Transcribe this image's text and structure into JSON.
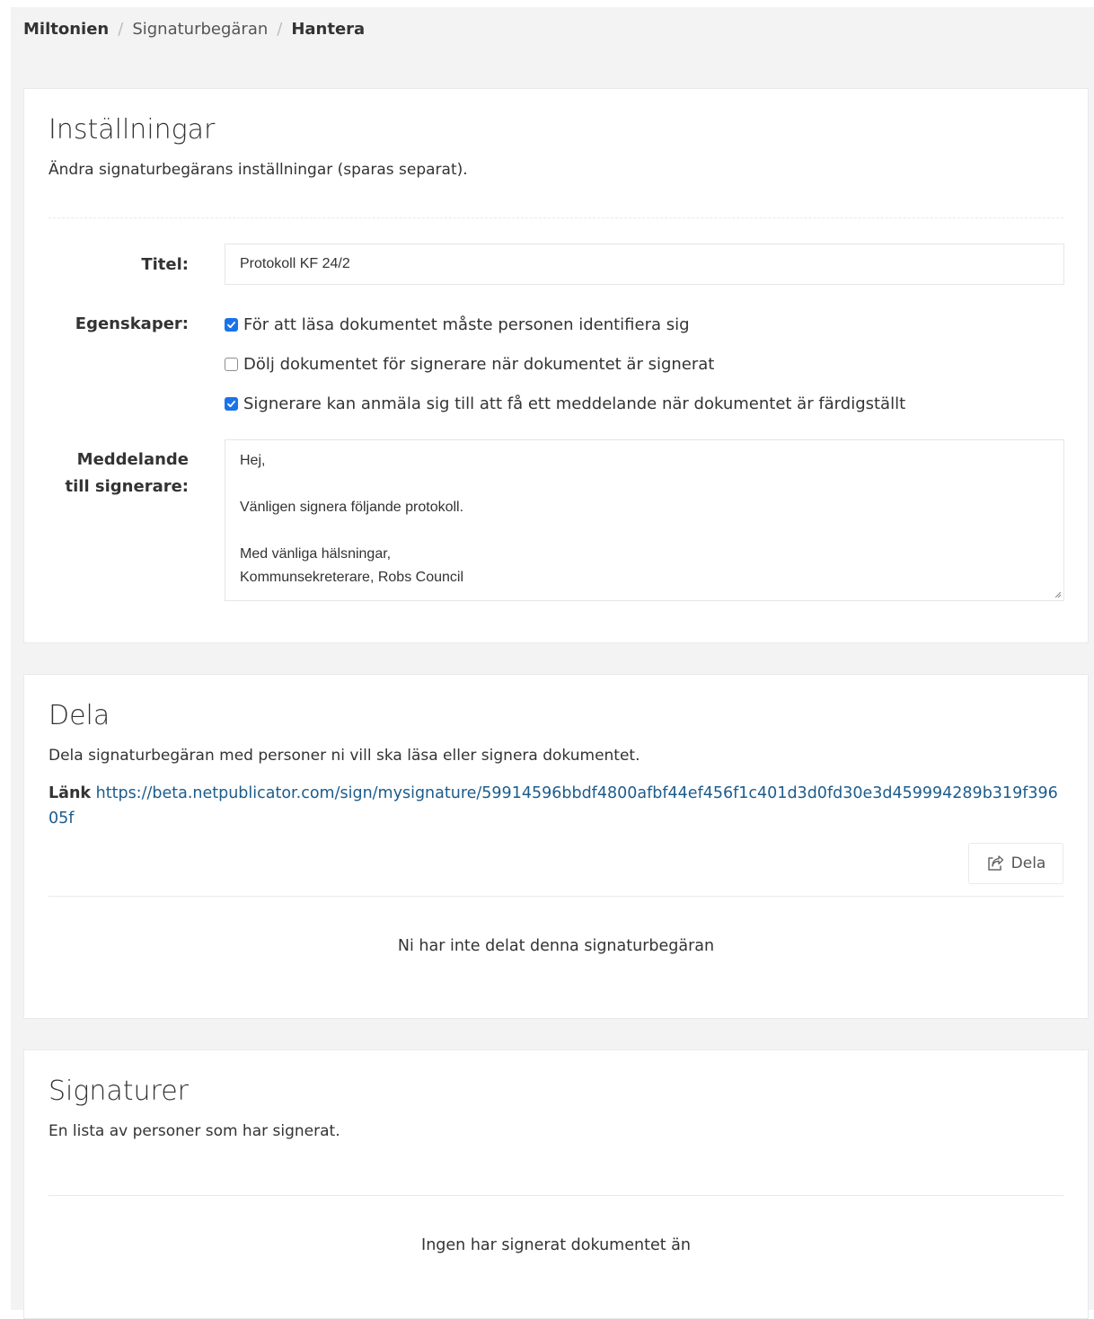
{
  "breadcrumb": {
    "root": "Miltonien",
    "parent": "Signaturbegäran",
    "current": "Hantera",
    "separator": "/"
  },
  "settings": {
    "title": "Inställningar",
    "description": "Ändra signaturbegärans inställningar (sparas separat).",
    "title_field": {
      "label": "Titel:",
      "value": "Protokoll KF 24/2"
    },
    "properties": {
      "label": "Egenskaper:",
      "options": [
        {
          "label": "För att läsa dokumentet måste personen identifiera sig",
          "checked": true
        },
        {
          "label": "Dölj dokumentet för signerare när dokumentet är signerat",
          "checked": false
        },
        {
          "label": "Signerare kan anmäla sig till att få ett meddelande när dokumentet är färdigställt",
          "checked": true
        }
      ]
    },
    "message": {
      "label_line1": "Meddelande",
      "label_line2": "till signerare:",
      "lines": [
        "Hej,",
        "",
        "Vänligen signera följande protokoll.",
        "",
        "Med vänliga hälsningar,",
        "Kommunsekreterare, Robs Council"
      ]
    }
  },
  "share": {
    "title": "Dela",
    "description": "Dela signaturbegäran med personer ni vill ska läsa eller signera dokumentet.",
    "link_label": "Länk",
    "link_url": "https://beta.netpublicator.com/sign/mysignature/59914596bbdf4800afbf44ef456f1c401d3d0fd30e3d459994289b319f39605f",
    "button_label": "Dela",
    "empty_text": "Ni har inte delat denna signaturbegäran"
  },
  "signatures": {
    "title": "Signaturer",
    "description": "En lista av personer som har signerat.",
    "empty_text": "Ingen har signerat dokumentet än"
  },
  "colors": {
    "checkbox_checked": "#1a73e8",
    "link": "#1c5c8c",
    "page_background": "#f3f3f4"
  },
  "icons": {
    "share_button": "share-square-icon",
    "checkbox_checked": "checkmark-icon"
  }
}
